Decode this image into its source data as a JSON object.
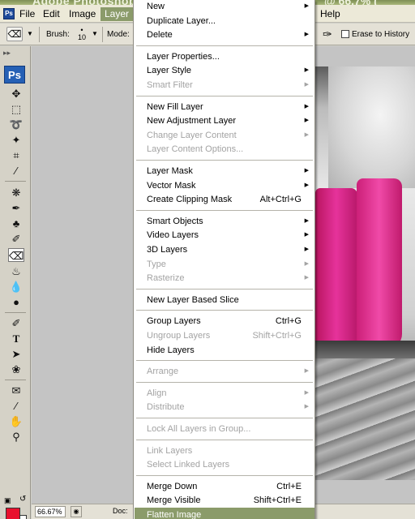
{
  "title_partial": "Adobe Photoshop",
  "title_partial_right": "@ 66.7% (",
  "menubar": {
    "items": [
      "File",
      "Edit",
      "Image",
      "Layer",
      "Help"
    ],
    "active": "Layer"
  },
  "options": {
    "brush_label": "Brush:",
    "brush_size": "10",
    "mode_label": "Mode:",
    "erase_to_history": "Erase to History"
  },
  "tools": {
    "logo": "Ps",
    "icons": [
      "move-tool-icon",
      "marquee-tool-icon",
      "lasso-tool-icon",
      "magic-wand-icon",
      "crop-tool-icon",
      "eyedropper-tool-icon",
      "healing-brush-icon",
      "brush-tool-icon",
      "clone-stamp-icon",
      "history-brush-icon",
      "eraser-tool-icon",
      "paint-bucket-icon",
      "blur-tool-icon",
      "dodge-tool-icon",
      "pen-tool-icon",
      "type-tool-icon",
      "path-selection-icon",
      "custom-shape-icon",
      "notes-tool-icon",
      "eyedropper-sample-icon",
      "hand-tool-icon",
      "zoom-tool-icon"
    ],
    "active": "eraser-tool-icon",
    "foreground_color": "#e8102d",
    "background_color": "#ffffff"
  },
  "status": {
    "zoom": "66.67%",
    "doc_label": "Doc:"
  },
  "layer_menu": {
    "groups": [
      [
        {
          "label": "New",
          "submenu": true
        },
        {
          "label": "Duplicate Layer..."
        },
        {
          "label": "Delete",
          "submenu": true
        }
      ],
      [
        {
          "label": "Layer Properties..."
        },
        {
          "label": "Layer Style",
          "submenu": true
        },
        {
          "label": "Smart Filter",
          "submenu": true,
          "disabled": true
        }
      ],
      [
        {
          "label": "New Fill Layer",
          "submenu": true
        },
        {
          "label": "New Adjustment Layer",
          "submenu": true
        },
        {
          "label": "Change Layer Content",
          "submenu": true,
          "disabled": true
        },
        {
          "label": "Layer Content Options...",
          "disabled": true
        }
      ],
      [
        {
          "label": "Layer Mask",
          "submenu": true
        },
        {
          "label": "Vector Mask",
          "submenu": true
        },
        {
          "label": "Create Clipping Mask",
          "shortcut": "Alt+Ctrl+G"
        }
      ],
      [
        {
          "label": "Smart Objects",
          "submenu": true
        },
        {
          "label": "Video Layers",
          "submenu": true
        },
        {
          "label": "3D Layers",
          "submenu": true
        },
        {
          "label": "Type",
          "submenu": true,
          "disabled": true
        },
        {
          "label": "Rasterize",
          "submenu": true,
          "disabled": true
        }
      ],
      [
        {
          "label": "New Layer Based Slice"
        }
      ],
      [
        {
          "label": "Group Layers",
          "shortcut": "Ctrl+G"
        },
        {
          "label": "Ungroup Layers",
          "shortcut": "Shift+Ctrl+G",
          "disabled": true
        },
        {
          "label": "Hide Layers"
        }
      ],
      [
        {
          "label": "Arrange",
          "submenu": true,
          "disabled": true
        }
      ],
      [
        {
          "label": "Align",
          "submenu": true,
          "disabled": true
        },
        {
          "label": "Distribute",
          "submenu": true,
          "disabled": true
        }
      ],
      [
        {
          "label": "Lock All Layers in Group...",
          "disabled": true
        }
      ],
      [
        {
          "label": "Link Layers",
          "disabled": true
        },
        {
          "label": "Select Linked Layers",
          "disabled": true
        }
      ],
      [
        {
          "label": "Merge Down",
          "shortcut": "Ctrl+E"
        },
        {
          "label": "Merge Visible",
          "shortcut": "Shift+Ctrl+E"
        },
        {
          "label": "Flatten Image",
          "highlighted": true
        }
      ]
    ]
  }
}
